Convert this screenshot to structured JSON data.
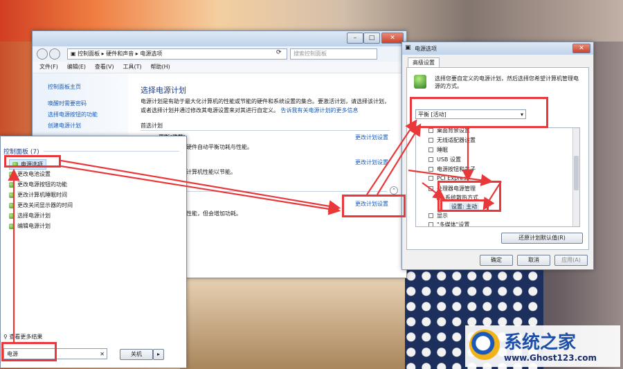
{
  "main_window": {
    "breadcrumb": [
      "控制面板",
      "硬件和声音",
      "电源选项"
    ],
    "search_placeholder": "搜索控制面板",
    "menu": [
      "文件(F)",
      "编辑(E)",
      "查看(V)",
      "工具(T)",
      "帮助(H)"
    ],
    "sidebar": [
      "控制面板主页",
      "唤醒时需要密码",
      "选择电源按钮的功能",
      "创建电源计划"
    ],
    "heading": "选择电源计划",
    "description": "电源计划是有助于最大化计算机的性能或节能的硬件和系统设置的集合。要激活计划，请选择该计划，或者选择计划并通过修改其电源设置来对其进行自定义。",
    "desc_link": "告诉我有关电源计划的更多信息",
    "plans_header": "首选计划",
    "plan_balanced": "平衡(推荐)",
    "plan_snippet1": "利用可用的硬件自动平衡功耗与性能。",
    "plan_snippet2": "尽可能降低计算机性能以节能。",
    "plan_snippet3": "有利于提高性能，但会增加功耗。",
    "link_change_1": "更改计划设置",
    "link_change_2": "更改计划设置",
    "link_change_3": "更改计划设置"
  },
  "start_panel": {
    "group_header": "控制面板 (7)",
    "items": [
      "电源选项",
      "更改电池设置",
      "更改电源按钮的功能",
      "更改计算机睡眠时间",
      "更改关闭显示器的时间",
      "选择电源计划",
      "编辑电源计划"
    ],
    "see_more": "查看更多结果",
    "search_value": "电源",
    "shutdown_label": "关机"
  },
  "dialog": {
    "title": "电源选项",
    "tab": "高级设置",
    "intro": "选择您要自定义的电源计划，然后选择您希望计算机管理电源的方式。",
    "plan_selected": "平衡 [活动]",
    "tree": [
      "桌面背景设置",
      "无线适配器设置",
      "睡眠",
      "USB 设置",
      "电源按钮和盖子",
      "PCI Express",
      "处理器电源管理",
      "系统散热方式",
      "设置: 主动",
      "显示",
      "\"多媒体\"设置"
    ],
    "restore_button": "还原计划默认值(R)",
    "ok": "确定",
    "cancel": "取消",
    "apply": "应用(A)"
  },
  "watermark": {
    "site_name": "系统之家",
    "url": "www.Ghost123.com"
  },
  "colors": {
    "annotation_red": "#e8383a",
    "link_blue": "#1c5bb3"
  }
}
